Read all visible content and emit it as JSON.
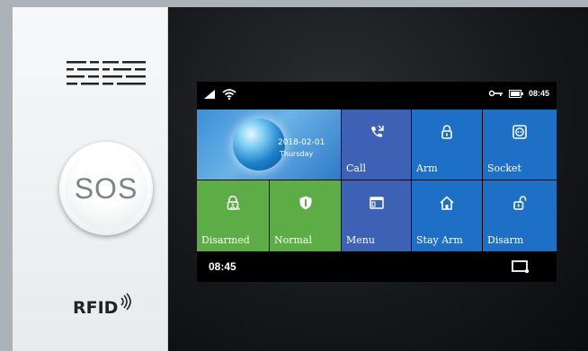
{
  "device": {
    "sos_label": "SOS",
    "rfid_label": "RFID"
  },
  "status_bar": {
    "time": "08:45",
    "icons": [
      "signal-icon",
      "wifi-icon",
      "key-icon",
      "battery-icon"
    ]
  },
  "date_tile": {
    "date": "2018-02-01",
    "weekday": "Thursday"
  },
  "tiles": [
    {
      "label": "Call",
      "icon": "phone-call-icon"
    },
    {
      "label": "Arm",
      "icon": "lock-icon"
    },
    {
      "label": "Socket",
      "icon": "socket-icon"
    },
    {
      "label": "Disarmed",
      "icon": "person-lock-icon"
    },
    {
      "label": "Normal",
      "icon": "shield-icon"
    },
    {
      "label": "Menu",
      "icon": "menu-window-icon"
    },
    {
      "label": "Stay Arm",
      "icon": "home-icon"
    },
    {
      "label": "Disarm",
      "icon": "unlock-icon"
    }
  ],
  "bottom_bar": {
    "time": "08:45",
    "icon": "screen-cast-icon"
  },
  "colors": {
    "tile_blue": "#1e6fc6",
    "tile_blue_mid": "#3d62b5",
    "tile_green": "#5cad45"
  }
}
